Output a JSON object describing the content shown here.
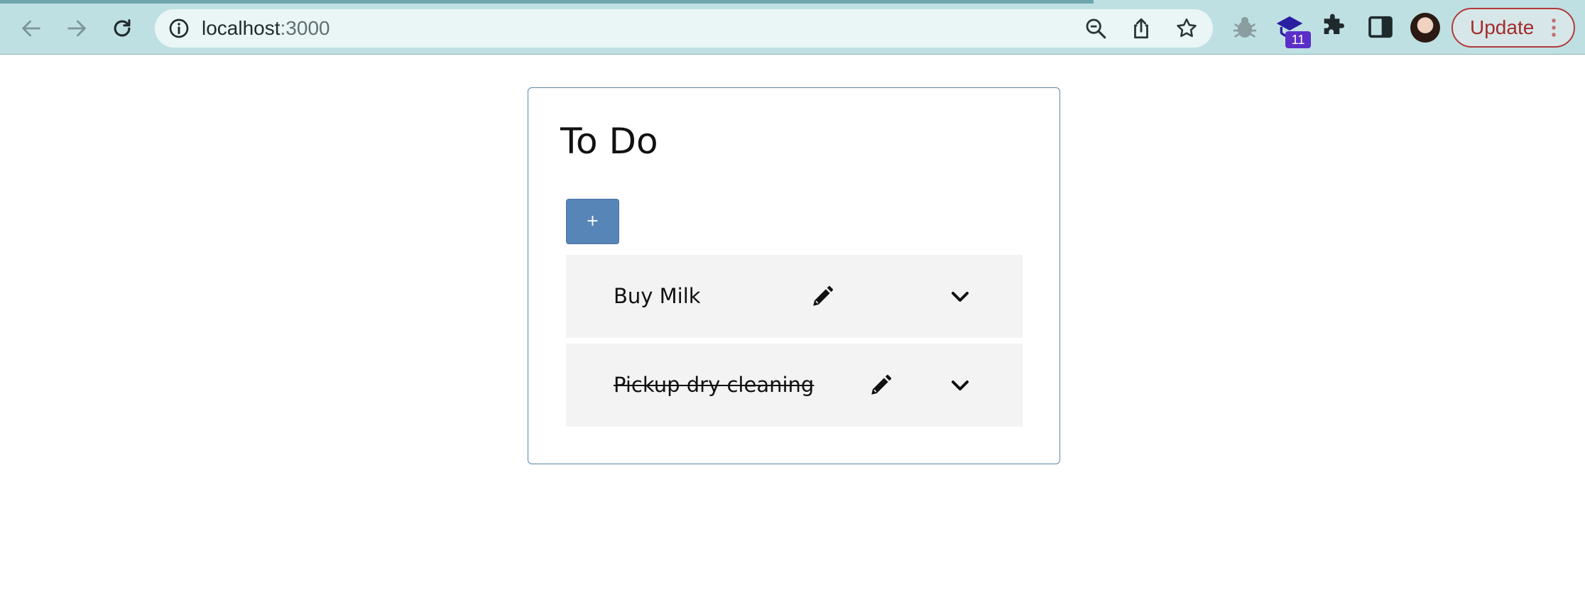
{
  "browser": {
    "url_host": "localhost",
    "url_port": ":3000",
    "extension_badge": "11",
    "update_label": "Update",
    "icons": {
      "back": "arrow-left-icon",
      "forward": "arrow-right-icon",
      "reload": "reload-icon",
      "site_info": "info-icon",
      "zoom": "zoom-out-icon",
      "share": "share-icon",
      "bookmark": "star-icon",
      "menu": "kebab-icon"
    },
    "colors": {
      "toolbar": "#bfe0e3",
      "update_text": "#a32c2c"
    }
  },
  "app": {
    "title": "To Do",
    "add_button_label": "+",
    "todos": [
      {
        "text": "Buy Milk",
        "completed": false
      },
      {
        "text": "Pickup dry cleaning",
        "completed": true
      }
    ],
    "colors": {
      "accent": "#5885b8",
      "item_background": "#f3f3f3",
      "card_border": "#5b86a6"
    }
  }
}
